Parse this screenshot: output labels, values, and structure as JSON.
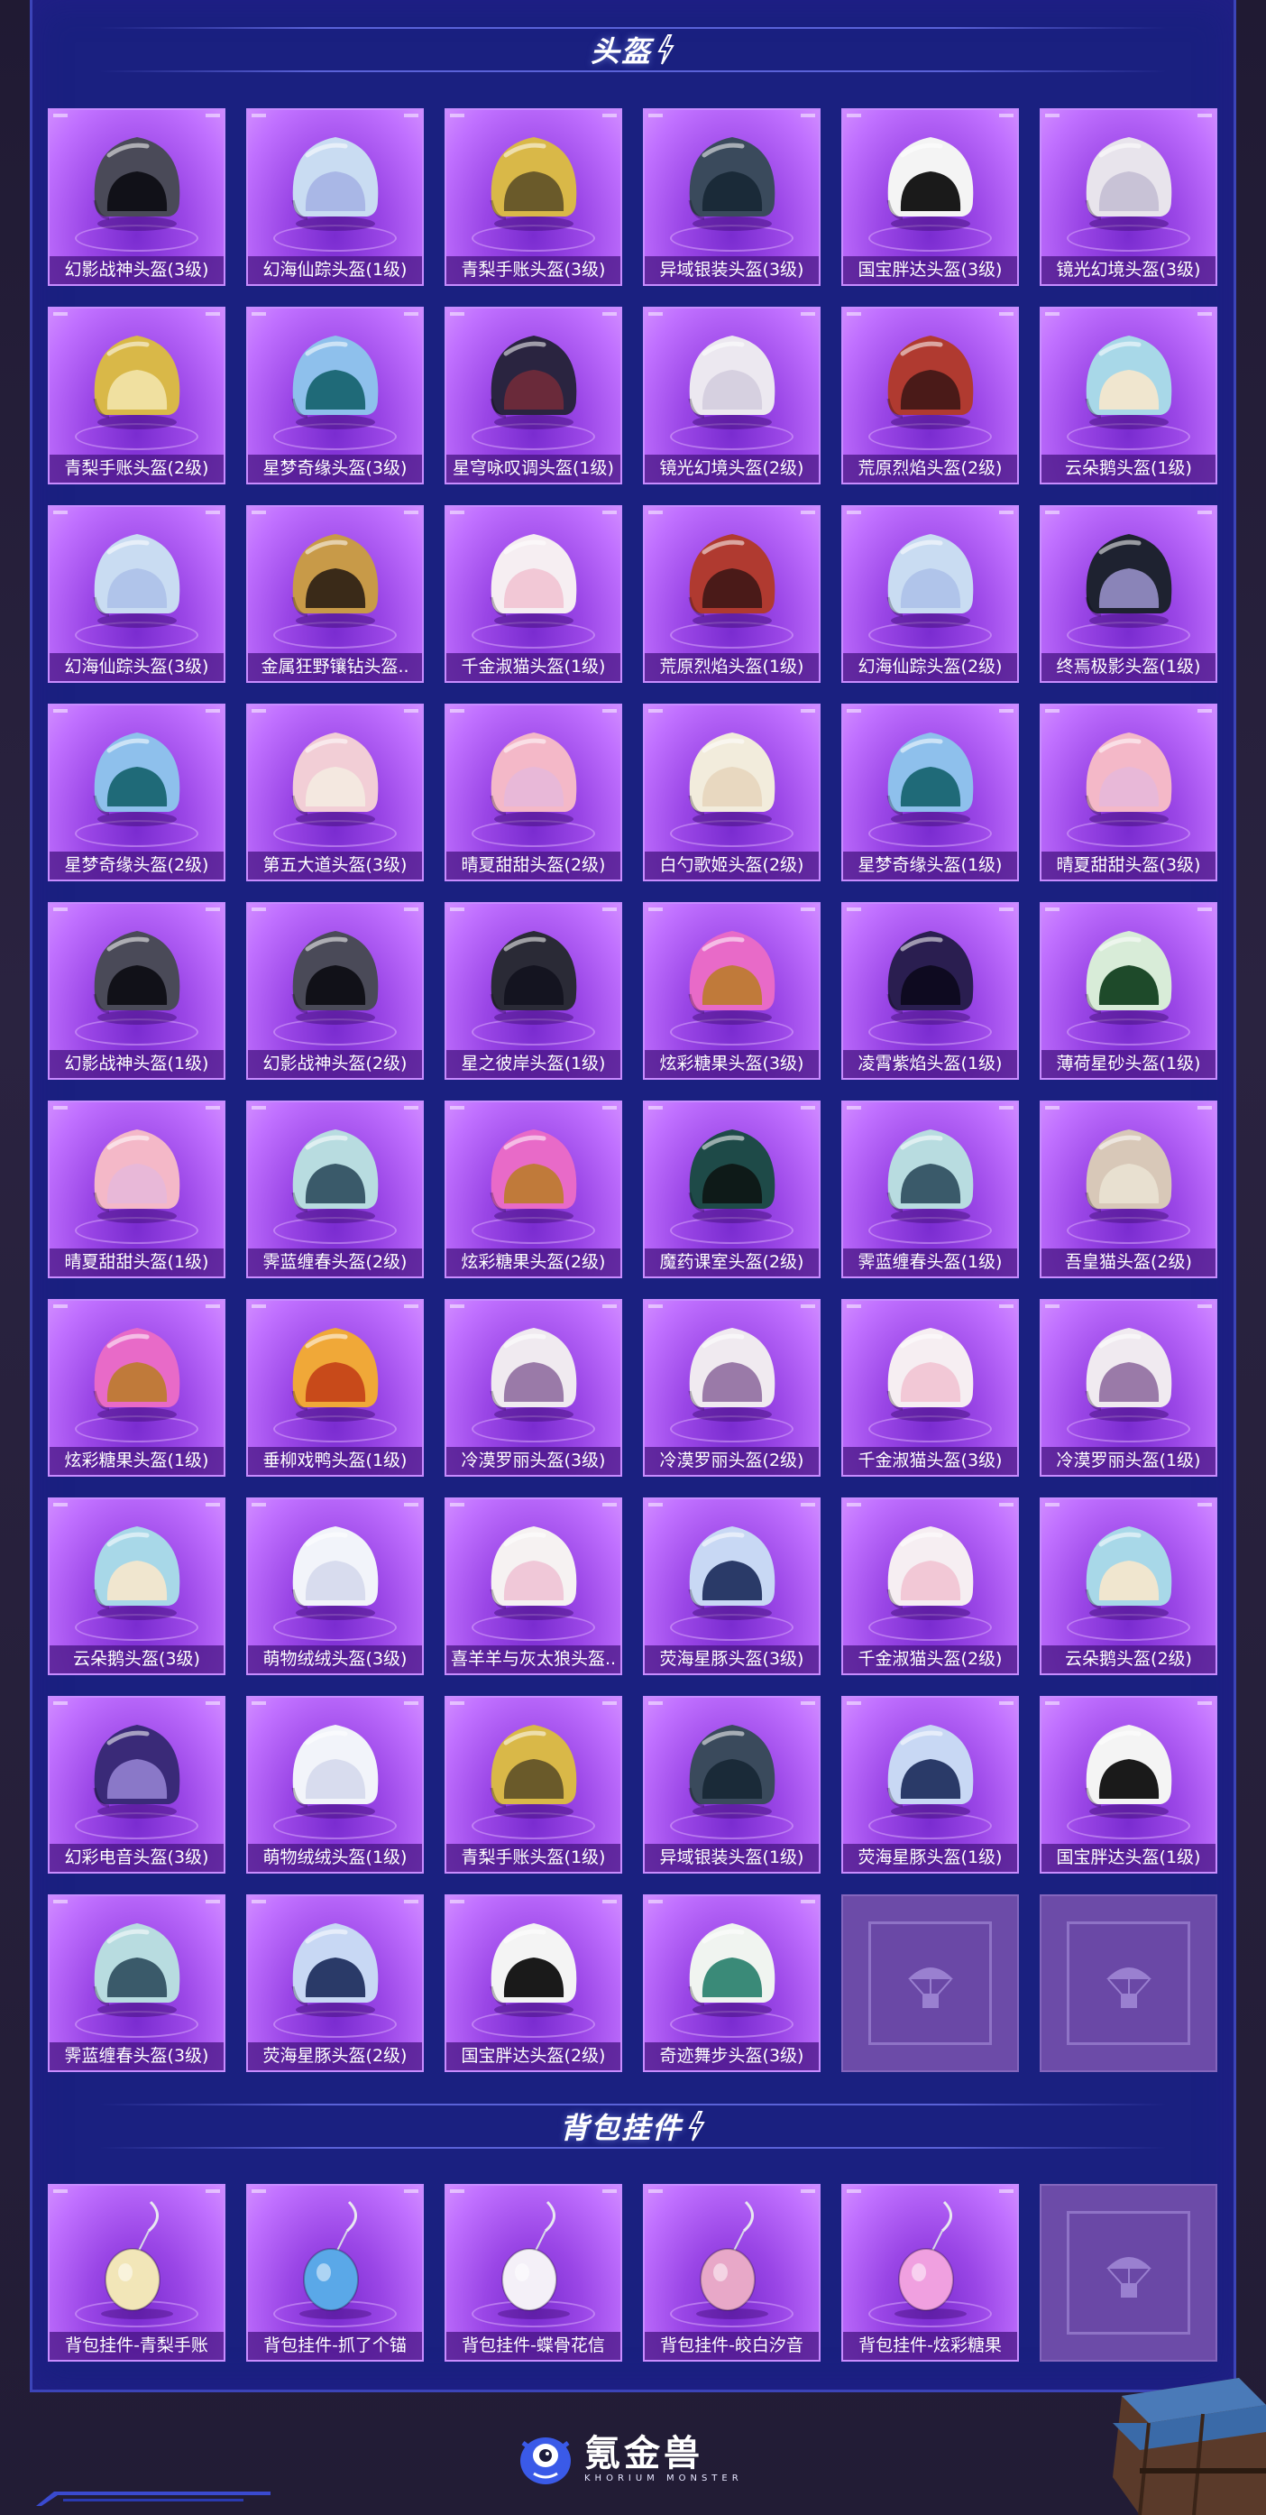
{
  "sections": {
    "helmets": {
      "title": "头盔"
    },
    "pendants": {
      "title": "背包挂件"
    }
  },
  "helmets": [
    {
      "name": "幻影战神头盔(3级)",
      "shell": "#4a4a58",
      "visor": "#111118"
    },
    {
      "name": "幻海仙踪头盔(1级)",
      "shell": "#c9dcf2",
      "visor": "#a9b7e6"
    },
    {
      "name": "青梨手账头盔(3级)",
      "shell": "#d9b848",
      "visor": "#6a5a2a"
    },
    {
      "name": "异域银装头盔(3级)",
      "shell": "#3a4a5c",
      "visor": "#1a2a38"
    },
    {
      "name": "国宝胖达头盔(3级)",
      "shell": "#f4f4f4",
      "visor": "#1a1a1a"
    },
    {
      "name": "镜光幻境头盔(3级)",
      "shell": "#e8e4ec",
      "visor": "#c8c2d6"
    },
    {
      "name": "青梨手账头盔(2级)",
      "shell": "#d9b848",
      "visor": "#f0e0a0"
    },
    {
      "name": "星梦奇缘头盔(3级)",
      "shell": "#8ec0ec",
      "visor": "#1f6a78"
    },
    {
      "name": "星穹咏叹调头盔(1级)",
      "shell": "#2a2440",
      "visor": "#6a2a3a"
    },
    {
      "name": "镜光幻境头盔(2级)",
      "shell": "#ece8f0",
      "visor": "#d6d0e0"
    },
    {
      "name": "荒原烈焰头盔(2级)",
      "shell": "#b03a30",
      "visor": "#4a1a18"
    },
    {
      "name": "云朵鹅头盔(1级)",
      "shell": "#a8d8e8",
      "visor": "#f0e6cf"
    },
    {
      "name": "幻海仙踪头盔(3级)",
      "shell": "#c9dcf2",
      "visor": "#b0c4ea"
    },
    {
      "name": "金属狂野镶钻头盔..",
      "shell": "#c89a48",
      "visor": "#3a2a18"
    },
    {
      "name": "千金淑猫头盔(1级)",
      "shell": "#f6eef2",
      "visor": "#f2c8d6"
    },
    {
      "name": "荒原烈焰头盔(1级)",
      "shell": "#b03a30",
      "visor": "#4a1a18"
    },
    {
      "name": "幻海仙踪头盔(2级)",
      "shell": "#c9dcf2",
      "visor": "#b0c4ea"
    },
    {
      "name": "终焉极影头盔(1级)",
      "shell": "#1e2230",
      "visor": "#8a84b8"
    },
    {
      "name": "星梦奇缘头盔(2级)",
      "shell": "#8ec0ec",
      "visor": "#1f6a78"
    },
    {
      "name": "第五大道头盔(3级)",
      "shell": "#f2ced6",
      "visor": "#f4e8e0"
    },
    {
      "name": "晴夏甜甜头盔(2级)",
      "shell": "#f4b8c8",
      "visor": "#e8b8d8"
    },
    {
      "name": "白勺歌姬头盔(2级)",
      "shell": "#f2ecdc",
      "visor": "#e8d8c0"
    },
    {
      "name": "星梦奇缘头盔(1级)",
      "shell": "#8ec0ec",
      "visor": "#1f6a78"
    },
    {
      "name": "晴夏甜甜头盔(3级)",
      "shell": "#f4b8c8",
      "visor": "#e8b8d8"
    },
    {
      "name": "幻影战神头盔(1级)",
      "shell": "#4a4a58",
      "visor": "#111118"
    },
    {
      "name": "幻影战神头盔(2级)",
      "shell": "#4a4a58",
      "visor": "#111118"
    },
    {
      "name": "星之彼岸头盔(1级)",
      "shell": "#2a2a36",
      "visor": "#141420"
    },
    {
      "name": "炫彩糖果头盔(3级)",
      "shell": "#e86ac8",
      "visor": "#c07a3a"
    },
    {
      "name": "凌霄紫焰头盔(1级)",
      "shell": "#2a1e50",
      "visor": "#0e0a20"
    },
    {
      "name": "薄荷星砂头盔(1级)",
      "shell": "#d8ecd8",
      "visor": "#1e4a2a"
    },
    {
      "name": "晴夏甜甜头盔(1级)",
      "shell": "#f4b8c8",
      "visor": "#e8b8d8"
    },
    {
      "name": "霁蓝缠春头盔(2级)",
      "shell": "#b8dce0",
      "visor": "#3a5a6a"
    },
    {
      "name": "炫彩糖果头盔(2级)",
      "shell": "#e86ac8",
      "visor": "#c07a3a"
    },
    {
      "name": "魔药课室头盔(2级)",
      "shell": "#1e4a48",
      "visor": "#0e1a18"
    },
    {
      "name": "霁蓝缠春头盔(1级)",
      "shell": "#b8dce0",
      "visor": "#3a5a6a"
    },
    {
      "name": "吾皇猫头盔(2级)",
      "shell": "#d8c8b8",
      "visor": "#e8e0d0"
    },
    {
      "name": "炫彩糖果头盔(1级)",
      "shell": "#e86ac8",
      "visor": "#c07a3a"
    },
    {
      "name": "垂柳戏鸭头盔(1级)",
      "shell": "#f0a838",
      "visor": "#c84a1a"
    },
    {
      "name": "冷漠罗丽头盔(3级)",
      "shell": "#f0eaf0",
      "visor": "#9a7aa8"
    },
    {
      "name": "冷漠罗丽头盔(2级)",
      "shell": "#f0eaf0",
      "visor": "#9a7aa8"
    },
    {
      "name": "千金淑猫头盔(3级)",
      "shell": "#f6eef2",
      "visor": "#f2c8d6"
    },
    {
      "name": "冷漠罗丽头盔(1级)",
      "shell": "#f0eaf0",
      "visor": "#9a7aa8"
    },
    {
      "name": "云朵鹅头盔(3级)",
      "shell": "#a8d8e8",
      "visor": "#f0e6cf"
    },
    {
      "name": "萌物绒绒头盔(3级)",
      "shell": "#f2f4fa",
      "visor": "#d8dcee"
    },
    {
      "name": "喜羊羊与灰太狼头盔..",
      "shell": "#f6f2f2",
      "visor": "#f0c8d8"
    },
    {
      "name": "荧海星豚头盔(3级)",
      "shell": "#c8d8f4",
      "visor": "#2a3a68"
    },
    {
      "name": "千金淑猫头盔(2级)",
      "shell": "#f6eef2",
      "visor": "#f2c8d6"
    },
    {
      "name": "云朵鹅头盔(2级)",
      "shell": "#a8d8e8",
      "visor": "#f0e6cf"
    },
    {
      "name": "幻彩电音头盔(3级)",
      "shell": "#3a2a78",
      "visor": "#8a78c8"
    },
    {
      "name": "萌物绒绒头盔(1级)",
      "shell": "#f2f4fa",
      "visor": "#d8dcee"
    },
    {
      "name": "青梨手账头盔(1级)",
      "shell": "#d9b848",
      "visor": "#6a5a2a"
    },
    {
      "name": "异域银装头盔(1级)",
      "shell": "#3a4a5c",
      "visor": "#1a2a38"
    },
    {
      "name": "荧海星豚头盔(1级)",
      "shell": "#c8d8f4",
      "visor": "#2a3a68"
    },
    {
      "name": "国宝胖达头盔(1级)",
      "shell": "#f4f4f4",
      "visor": "#1a1a1a"
    },
    {
      "name": "霁蓝缠春头盔(3级)",
      "shell": "#b8dce0",
      "visor": "#3a5a6a"
    },
    {
      "name": "荧海星豚头盔(2级)",
      "shell": "#c8d8f4",
      "visor": "#2a3a68"
    },
    {
      "name": "国宝胖达头盔(2级)",
      "shell": "#f4f4f4",
      "visor": "#1a1a1a"
    },
    {
      "name": "奇迹舞步头盔(3级)",
      "shell": "#f0f4f0",
      "visor": "#3a8a78"
    }
  ],
  "pendants": [
    {
      "name": "背包挂件-青梨手账",
      "color": "#f2e6b8"
    },
    {
      "name": "背包挂件-抓了个锚",
      "color": "#5aa8e8"
    },
    {
      "name": "背包挂件-蝶骨花信",
      "color": "#f4f0f8"
    },
    {
      "name": "背包挂件-皎白汐音",
      "color": "#e8a8c8"
    },
    {
      "name": "背包挂件-炫彩糖果",
      "color": "#f0a0e0"
    }
  ],
  "footer": {
    "brand": "氪金兽",
    "brand_sub": "KHORIUM MONSTER"
  },
  "colors": {
    "panel": "#1a2080",
    "card_border": "#c88cff",
    "empty_slot": "#6c4ba8"
  }
}
